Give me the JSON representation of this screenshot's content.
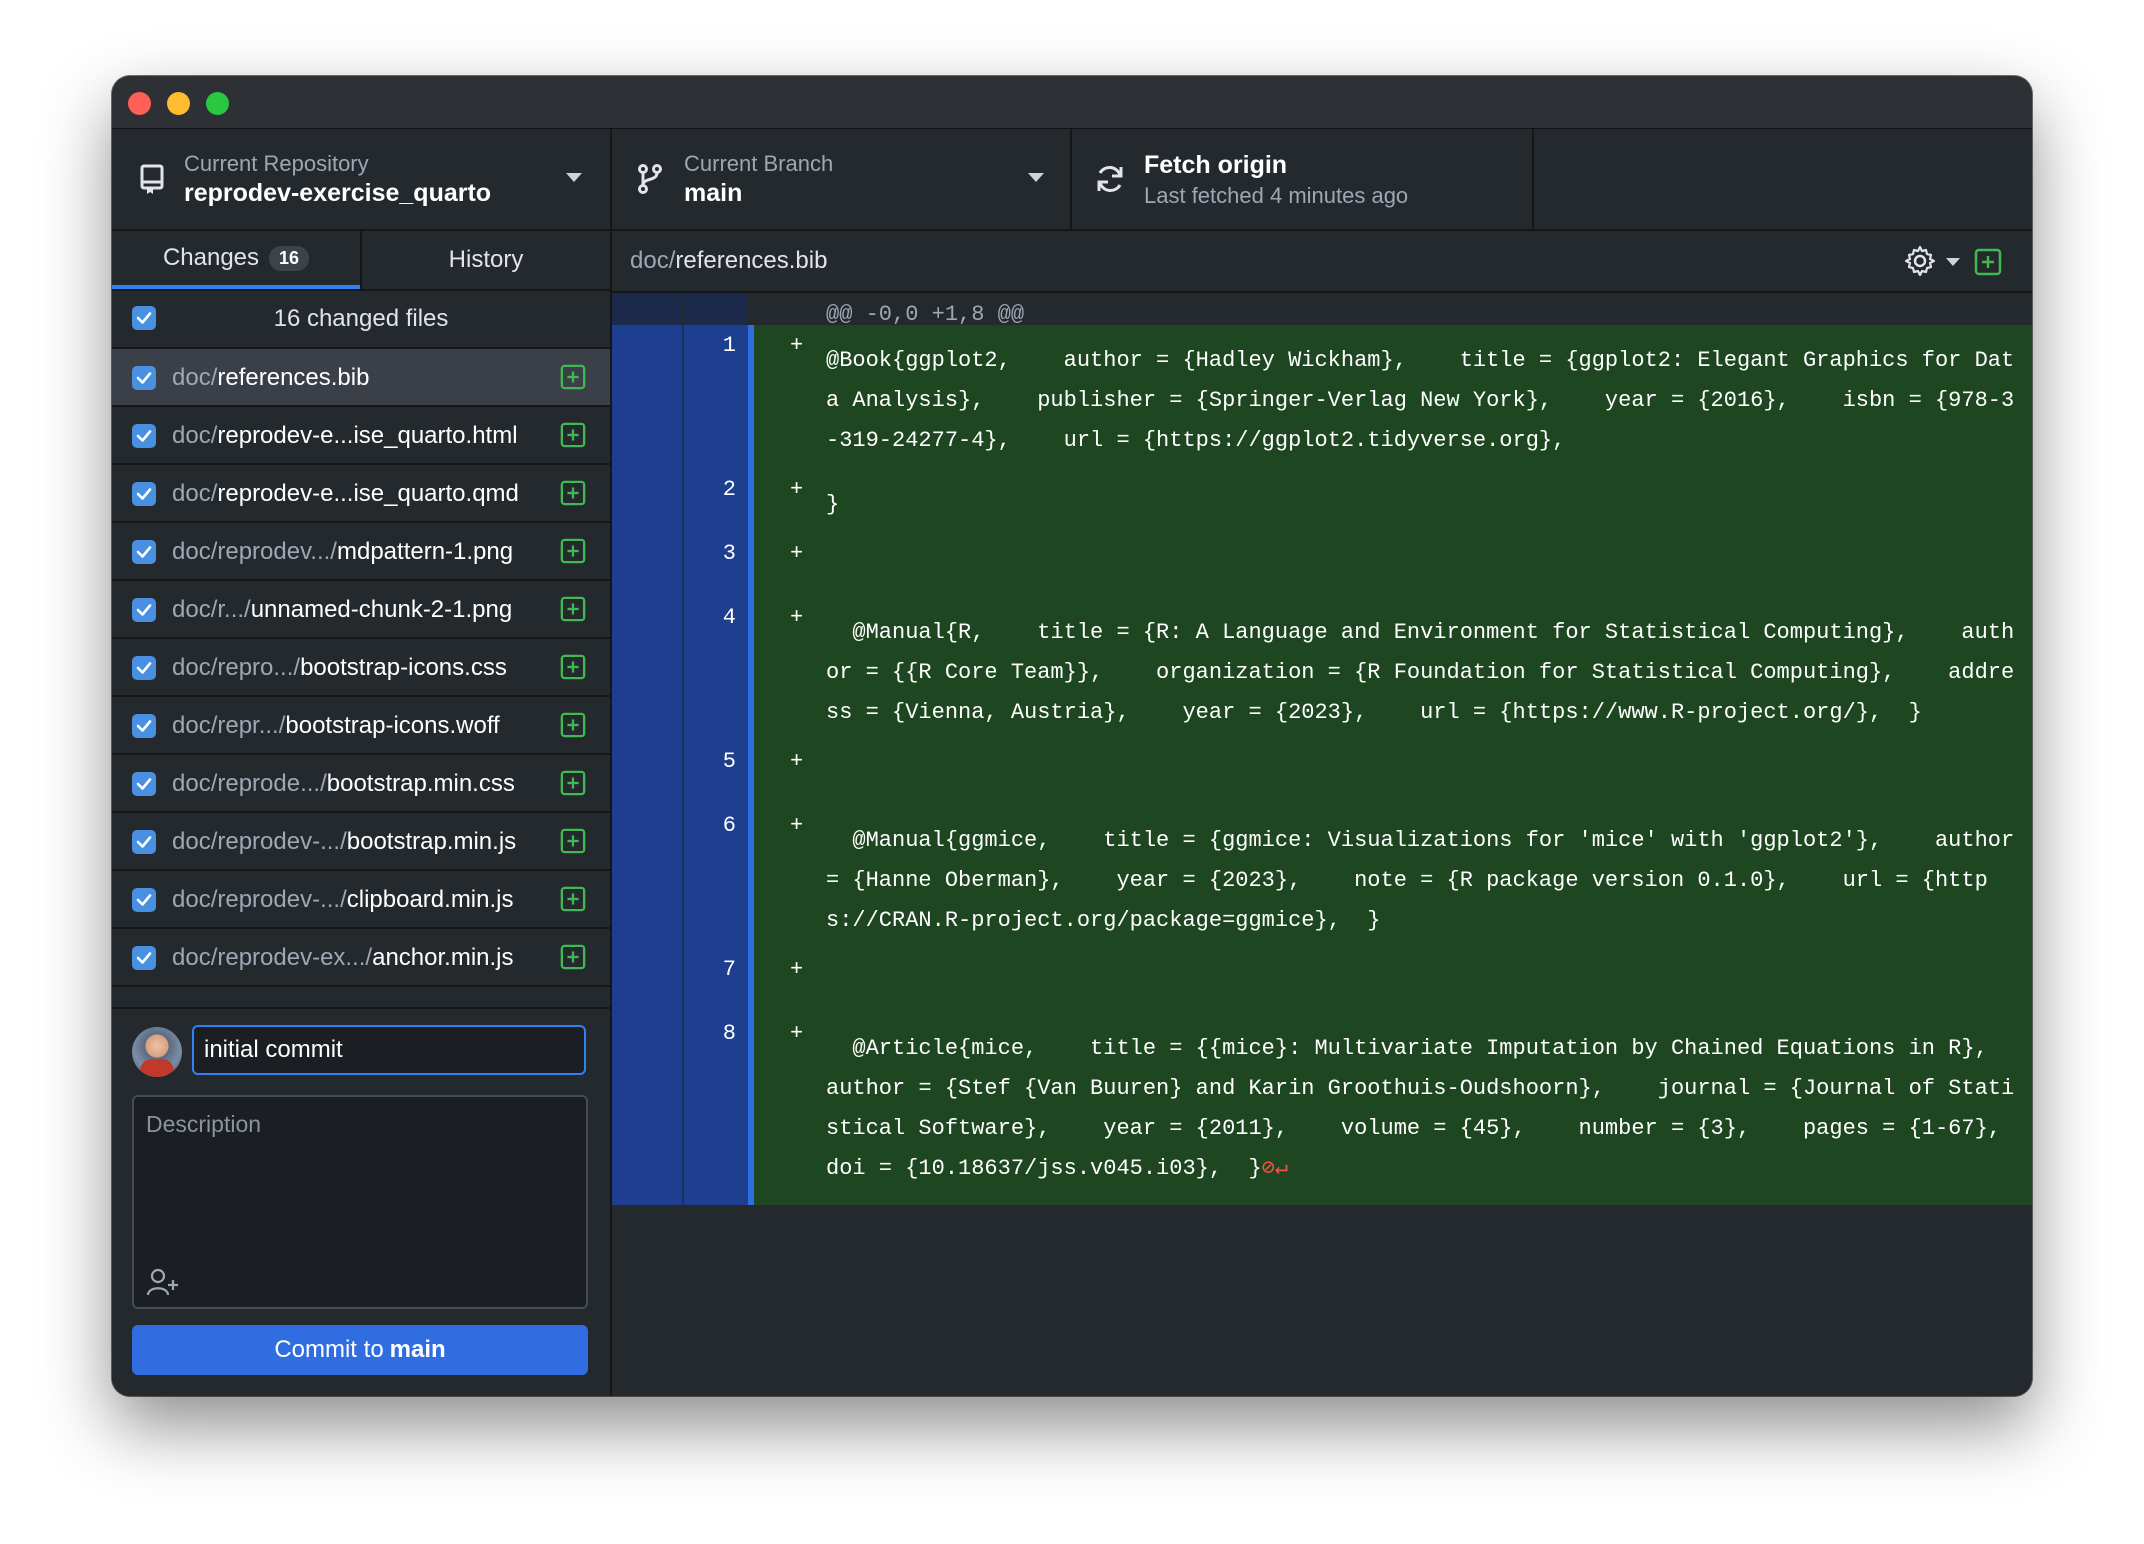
{
  "toolbar": {
    "repo_label": "Current Repository",
    "repo_name": "reprodev-exercise_quarto",
    "branch_label": "Current Branch",
    "branch_name": "main",
    "fetch_label": "Fetch origin",
    "fetch_status": "Last fetched 4 minutes ago"
  },
  "tabs": {
    "changes_label": "Changes",
    "changes_count": "16",
    "history_label": "History"
  },
  "files": {
    "header": "16 changed files",
    "items": [
      {
        "dir": "doc/",
        "name": "references.bib"
      },
      {
        "dir": "doc/",
        "name": "reprodev-e...ise_quarto.html"
      },
      {
        "dir": "doc/",
        "name": "reprodev-e...ise_quarto.qmd"
      },
      {
        "dir": "doc/reprodev.../",
        "name": "mdpattern-1.png"
      },
      {
        "dir": "doc/r.../",
        "name": "unnamed-chunk-2-1.png"
      },
      {
        "dir": "doc/repro.../",
        "name": "bootstrap-icons.css"
      },
      {
        "dir": "doc/repr.../",
        "name": "bootstrap-icons.woff"
      },
      {
        "dir": "doc/reprode.../",
        "name": "bootstrap.min.css"
      },
      {
        "dir": "doc/reprodev-.../",
        "name": "bootstrap.min.js"
      },
      {
        "dir": "doc/reprodev-.../",
        "name": "clipboard.min.js"
      },
      {
        "dir": "doc/reprodev-ex.../",
        "name": "anchor.min.js"
      }
    ]
  },
  "commit": {
    "summary": "initial commit",
    "description_placeholder": "Description",
    "button_prefix": "Commit to",
    "button_branch": "main"
  },
  "diff": {
    "path_dir": "doc/",
    "path_name": "references.bib",
    "hunk": "@@ -0,0 +1,8 @@",
    "lines": [
      {
        "num": "1",
        "sign": "+",
        "text": "@Book{ggplot2,    author = {Hadley Wickham},    title = {ggplot2: Elegant Graphics for Data Analysis},    publisher = {Springer-Verlag New York},    year = {2016},    isbn = {978-3-319-24277-4},    url = {https://ggplot2.tidyverse.org},"
      },
      {
        "num": "2",
        "sign": "+",
        "text": "}"
      },
      {
        "num": "3",
        "sign": "+",
        "text": ""
      },
      {
        "num": "4",
        "sign": "+",
        "text": "  @Manual{R,    title = {R: A Language and Environment for Statistical Computing},    author = {{R Core Team}},    organization = {R Foundation for Statistical Computing},    address = {Vienna, Austria},    year = {2023},    url = {https://www.R-project.org/},  }"
      },
      {
        "num": "5",
        "sign": "+",
        "text": ""
      },
      {
        "num": "6",
        "sign": "+",
        "text": "  @Manual{ggmice,    title = {ggmice: Visualizations for 'mice' with 'ggplot2'},    author = {Hanne Oberman},    year = {2023},    note = {R package version 0.1.0},    url = {https://CRAN.R-project.org/package=ggmice},  }"
      },
      {
        "num": "7",
        "sign": "+",
        "text": ""
      },
      {
        "num": "8",
        "sign": "+",
        "text": "  @Article{mice,    title = {{mice}: Multivariate Imputation by Chained Equations in R},    author = {Stef {Van Buuren} and Karin Groothuis-Oudshoorn},    journal = {Journal of Statistical Software},    year = {2011},    volume = {45},    number = {3},    pages = {1-67},    doi = {10.18637/jss.v045.i03},  }"
      }
    ],
    "eol_marker": "⊘↵"
  },
  "icons": {
    "repo": "repo-icon",
    "branch": "branch-icon",
    "fetch": "sync-icon",
    "gear": "gear-icon",
    "add": "file-added-icon",
    "coauthor": "add-coauthor-icon"
  },
  "colors": {
    "accent": "#2f81f7",
    "added_bg": "#1e4620",
    "gutter_bg": "#1e3f8f",
    "added_icon": "#3fb950"
  }
}
